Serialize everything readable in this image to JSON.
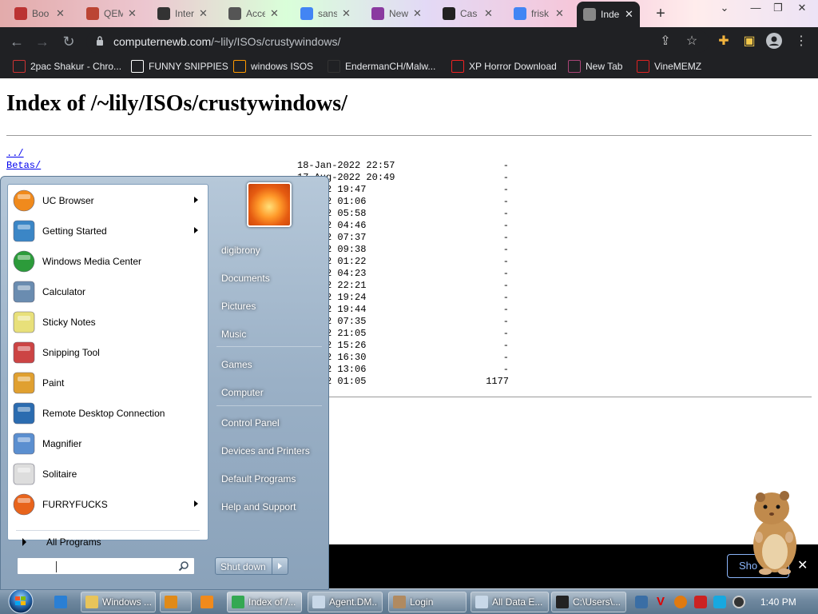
{
  "browser": {
    "tabs": [
      {
        "label": "Boo",
        "favicon": "tab-favicon-red",
        "color": "#b33"
      },
      {
        "label": "QEM",
        "favicon": "tab-favicon-qemu",
        "color": "#b43"
      },
      {
        "label": "Inter",
        "favicon": "tab-favicon-archive",
        "color": "#333"
      },
      {
        "label": "Acce",
        "favicon": "tab-favicon-lock",
        "color": "#555"
      },
      {
        "label": "sans",
        "favicon": "tab-favicon-google",
        "color": "#4285f4"
      },
      {
        "label": "New",
        "favicon": "tab-favicon-purple",
        "color": "#8a3aa0"
      },
      {
        "label": "Cas",
        "favicon": "tab-favicon-h",
        "color": "#222"
      },
      {
        "label": "frisk",
        "favicon": "tab-favicon-google",
        "color": "#4285f4"
      },
      {
        "label": "Inde",
        "favicon": "tab-favicon-lock",
        "color": "#888"
      }
    ],
    "url_host": "computernewb.com",
    "url_path": "/~lily/ISOs/crustywindows/",
    "bookmarks": [
      {
        "label": "2pac Shakur - Chro...",
        "icon": "bookmark-icon-fire",
        "color": "#c33"
      },
      {
        "label": "FUNNY SNIPPIES",
        "icon": "bookmark-icon-h",
        "color": "#fff"
      },
      {
        "label": "windows ISOS",
        "icon": "bookmark-icon-ph",
        "color": "#f90"
      },
      {
        "label": "EndermanCH/Malw...",
        "icon": "bookmark-icon-yp",
        "color": "#333"
      },
      {
        "label": "XP Horror Download",
        "icon": "bookmark-icon-x",
        "color": "#e22"
      },
      {
        "label": "New Tab",
        "icon": "bookmark-icon-globe",
        "color": "#a47"
      },
      {
        "label": "VineMEMZ",
        "icon": "bookmark-icon-r",
        "color": "#d22"
      }
    ]
  },
  "page": {
    "title": "Index of /~lily/ISOs/crustywindows/",
    "entries": [
      {
        "name": "../",
        "date": "",
        "size": ""
      },
      {
        "name": "Betas/",
        "date": "18-Jan-2022 22:57",
        "size": "-"
      },
      {
        "name": "",
        "date": "17-Aug-2022 20:49",
        "size": "-"
      },
      {
        "name": "",
        "date": "g-2022 19:47",
        "size": "-"
      },
      {
        "name": "",
        "date": "g-2022 01:06",
        "size": "-"
      },
      {
        "name": "",
        "date": "g-2022 05:58",
        "size": "-"
      },
      {
        "name": "",
        "date": "r-2022 04:46",
        "size": "-"
      },
      {
        "name": "",
        "date": "n-2022 07:37",
        "size": "-"
      },
      {
        "name": "",
        "date": "g-2022 09:38",
        "size": "-"
      },
      {
        "name": "",
        "date": "g-2022 01:22",
        "size": "-"
      },
      {
        "name": "",
        "date": "g-2022 04:23",
        "size": "-"
      },
      {
        "name": "",
        "date": "t-2022 22:21",
        "size": "-"
      },
      {
        "name": "",
        "date": "g-2022 19:24",
        "size": "-"
      },
      {
        "name": "",
        "date": "g-2022 19:44",
        "size": "-"
      },
      {
        "name": "",
        "date": "n-2022 07:35",
        "size": "-"
      },
      {
        "name": "",
        "date": "g-2022 21:05",
        "size": "-"
      },
      {
        "name": "",
        "date": "r-2022 15:26",
        "size": "-"
      },
      {
        "name": "",
        "date": "g-2022 16:30",
        "size": "-"
      },
      {
        "name": "",
        "date": "t-2022 13:06",
        "size": "-"
      },
      {
        "name": "",
        "date": "g-2022 01:05",
        "size": "1177"
      }
    ]
  },
  "notification": {
    "button_label": "Sho"
  },
  "start_menu": {
    "programs": [
      {
        "label": "UC Browser",
        "icon": "uc-browser-icon",
        "submenu": true
      },
      {
        "label": "Getting Started",
        "icon": "getting-started-icon",
        "submenu": true
      },
      {
        "label": "Windows Media Center",
        "icon": "media-center-icon",
        "submenu": false
      },
      {
        "label": "Calculator",
        "icon": "calculator-icon",
        "submenu": false
      },
      {
        "label": "Sticky Notes",
        "icon": "sticky-notes-icon",
        "submenu": false
      },
      {
        "label": "Snipping Tool",
        "icon": "snipping-tool-icon",
        "submenu": false
      },
      {
        "label": "Paint",
        "icon": "paint-icon",
        "submenu": false
      },
      {
        "label": "Remote Desktop Connection",
        "icon": "remote-desktop-icon",
        "submenu": false
      },
      {
        "label": "Magnifier",
        "icon": "magnifier-icon",
        "submenu": false
      },
      {
        "label": "Solitaire",
        "icon": "solitaire-icon",
        "submenu": false
      },
      {
        "label": "FURRYFUCKS",
        "icon": "firefox-icon",
        "submenu": true
      }
    ],
    "all_programs": "All Programs",
    "search_placeholder": "",
    "user_name": "digibrony",
    "right_links": [
      "Documents",
      "Pictures",
      "Music",
      "Games",
      "Computer",
      "Control Panel",
      "Devices and Printers",
      "Default Programs",
      "Help and Support"
    ],
    "shutdown_label": "Shut down"
  },
  "taskbar": {
    "items": [
      {
        "label": "",
        "icon": "ie-icon",
        "pinned": true
      },
      {
        "label": "Windows ...",
        "icon": "explorer-icon",
        "pinned": false
      },
      {
        "label": "",
        "icon": "media-player-icon",
        "pinned": false
      },
      {
        "label": "",
        "icon": "uc-browser-taskbar-icon",
        "pinned": true
      },
      {
        "label": "Index of /...",
        "icon": "chrome-icon",
        "pinned": false,
        "active": true
      },
      {
        "label": "Agent.DM...",
        "icon": "window-icon",
        "pinned": false
      },
      {
        "label": "Login",
        "icon": "login-icon",
        "pinned": false
      },
      {
        "label": "All Data E...",
        "icon": "window-icon",
        "pinned": false
      },
      {
        "label": "C:\\Users\\...",
        "icon": "cmd-icon",
        "pinned": false
      }
    ],
    "clock": "1:40 PM"
  }
}
